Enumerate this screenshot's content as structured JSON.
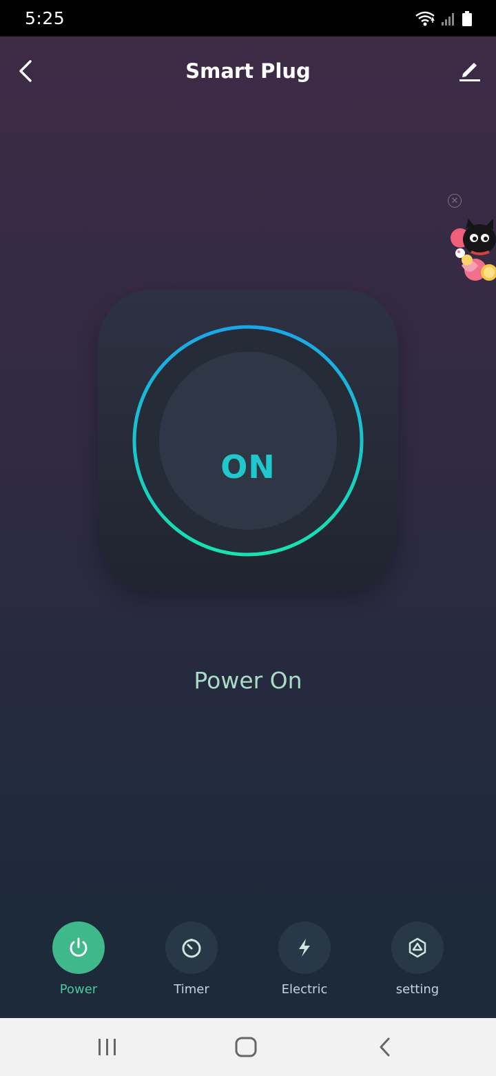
{
  "status_bar": {
    "time": "5:25",
    "icons": [
      "wifi-icon",
      "signal-icon",
      "battery-icon"
    ]
  },
  "header": {
    "title": "Smart Plug",
    "back_icon": "chevron-left-icon",
    "edit_icon": "pencil-icon"
  },
  "device": {
    "power_button_label": "ON",
    "power_status": "Power On",
    "ring_colors": [
      "#1aa6e8",
      "#17e3b0"
    ]
  },
  "promo": {
    "close_icon": "close-circle-icon",
    "art": "cat-with-hearts"
  },
  "bottom_nav": {
    "items": [
      {
        "label": "Power",
        "icon": "power-icon",
        "active": true
      },
      {
        "label": "Timer",
        "icon": "timer-icon",
        "active": false
      },
      {
        "label": "Electric",
        "icon": "lightning-icon",
        "active": false
      },
      {
        "label": "setting",
        "icon": "hexagon-settings-icon",
        "active": false
      }
    ]
  },
  "system_nav": {
    "items": [
      "recent-apps-icon",
      "home-icon",
      "back-icon"
    ]
  },
  "colors": {
    "accent": "#3fb98c",
    "on_text": "#1ec8cc",
    "status_text": "#a8dcc6"
  }
}
